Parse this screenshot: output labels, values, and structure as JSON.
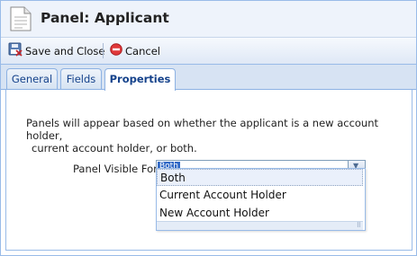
{
  "window": {
    "title": "Panel: Applicant"
  },
  "toolbar": {
    "save_close_label": "Save and Close",
    "cancel_label": "Cancel"
  },
  "tabs": [
    {
      "label": "General",
      "active": false
    },
    {
      "label": "Fields",
      "active": false
    },
    {
      "label": "Properties",
      "active": true
    }
  ],
  "properties": {
    "info_line1": "Panels will appear based on whether the applicant is a new account holder,",
    "info_line2": "current account holder, or both.",
    "visible_for_label": "Panel Visible For:",
    "visible_for_value": "Both",
    "options": [
      "Both",
      "Current Account Holder",
      "New Account Holder"
    ]
  },
  "colors": {
    "accent": "#15428b",
    "border": "#99bbe8",
    "selection": "#3169c6"
  },
  "icons": [
    "document-icon",
    "save-close-icon",
    "cancel-icon",
    "dropdown-arrow-icon",
    "resize-grip-icon"
  ]
}
